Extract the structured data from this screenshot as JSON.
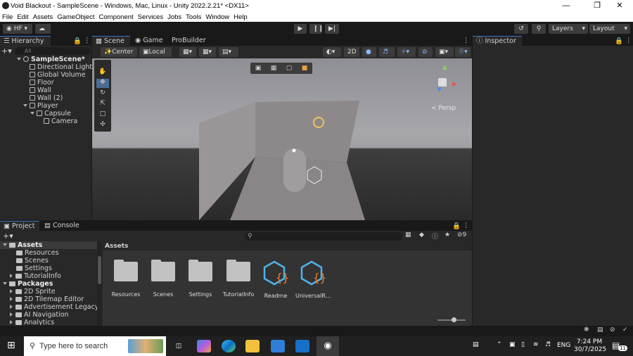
{
  "window": {
    "title": "Void Blackout - SampleScene - Windows, Mac, Linux - Unity 2022.2.21* <DX11>"
  },
  "menu": [
    "File",
    "Edit",
    "Assets",
    "GameObject",
    "Component",
    "Services",
    "Jobs",
    "Tools",
    "Window",
    "Help"
  ],
  "toolbar": {
    "account": "HF",
    "layers": "Layers",
    "layout": "Layout"
  },
  "hierarchy": {
    "tab": "Hierarchy",
    "search_placeholder": "All",
    "scene": "SampleScene*",
    "items": [
      "Directional Light",
      "Global Volume",
      "Floor",
      "Wall",
      "Wall (2)",
      "Player",
      "Capsule",
      "Camera"
    ]
  },
  "scene_view": {
    "tabs": [
      "Scene",
      "Game",
      "ProBuilder"
    ],
    "pivot": "Center",
    "space": "Local",
    "mode_2d": "2D",
    "persp": "Persp"
  },
  "inspector": {
    "tab": "Inspector"
  },
  "project": {
    "tabs": [
      "Project",
      "Console"
    ],
    "tree": {
      "assets": "Assets",
      "asset_children": [
        "Resources",
        "Scenes",
        "Settings",
        "TutorialInfo"
      ],
      "packages": "Packages",
      "package_children": [
        "2D Sprite",
        "2D Tilemap Editor",
        "Advertisement Legacy",
        "AI Navigation",
        "Analytics"
      ]
    },
    "breadcrumb": "Assets",
    "hidden_count": "9",
    "assets": [
      {
        "name": "Resources",
        "type": "folder"
      },
      {
        "name": "Scenes",
        "type": "folder"
      },
      {
        "name": "Settings",
        "type": "folder"
      },
      {
        "name": "TutorialInfo",
        "type": "folder"
      },
      {
        "name": "Readme",
        "type": "script"
      },
      {
        "name": "UniversalR...",
        "type": "script"
      }
    ]
  },
  "taskbar": {
    "search_placeholder": "Type here to search",
    "language": "ENG",
    "time": "7:24 PM",
    "date": "30/7/2025",
    "notifications": "11"
  }
}
